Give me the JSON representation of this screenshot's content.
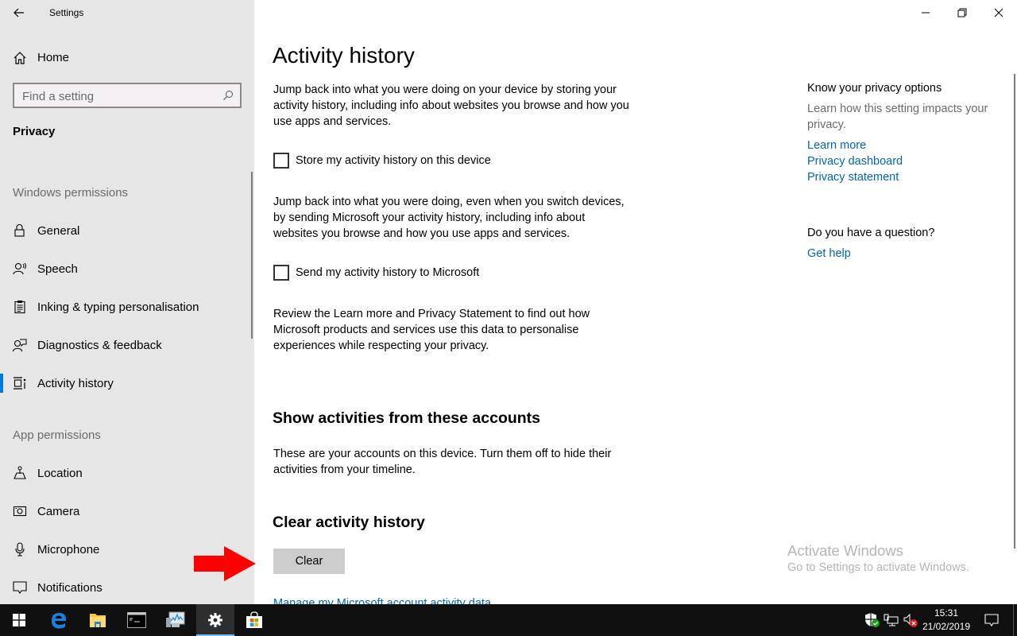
{
  "window": {
    "app_title": "Settings",
    "controls": {
      "minimize": "minimize-icon",
      "restore": "restore-icon",
      "close": "close-icon"
    }
  },
  "sidebar": {
    "home_label": "Home",
    "search_placeholder": "Find a setting",
    "category_title": "Privacy",
    "groups": [
      {
        "title": "Windows permissions",
        "items": [
          {
            "label": "General",
            "icon": "lock-icon"
          },
          {
            "label": "Speech",
            "icon": "speech-icon"
          },
          {
            "label": "Inking & typing personalisation",
            "icon": "clipboard-icon"
          },
          {
            "label": "Diagnostics & feedback",
            "icon": "feedback-icon"
          },
          {
            "label": "Activity history",
            "icon": "timeline-icon",
            "active": true
          }
        ]
      },
      {
        "title": "App permissions",
        "items": [
          {
            "label": "Location",
            "icon": "location-icon"
          },
          {
            "label": "Camera",
            "icon": "camera-icon"
          },
          {
            "label": "Microphone",
            "icon": "microphone-icon"
          },
          {
            "label": "Notifications",
            "icon": "notifications-icon"
          }
        ]
      }
    ]
  },
  "main": {
    "title": "Activity history",
    "intro": "Jump back into what you were doing on your device by storing your activity history, including info about websites you browse and how you use apps and services.",
    "store_checkbox": {
      "label": "Store my activity history on this device",
      "checked": false
    },
    "send_desc": "Jump back into what you were doing, even when you switch devices, by sending Microsoft your activity history, including info about websites you browse and how you use apps and services.",
    "send_checkbox": {
      "label": "Send my activity history to Microsoft",
      "checked": false
    },
    "review_text": "Review the Learn more and Privacy Statement to find out how Microsoft products and services use this data to personalise experiences while respecting your privacy.",
    "accounts_title": "Show activities from these accounts",
    "accounts_desc": "These are your accounts on this device. Turn them off to hide their activities from your timeline.",
    "clear_title": "Clear activity history",
    "clear_button": "Clear",
    "manage_link": "Manage my Microsoft account activity data"
  },
  "right_panel": {
    "privacy_title": "Know your privacy options",
    "privacy_desc": "Learn how this setting impacts your privacy.",
    "links": [
      "Learn more",
      "Privacy dashboard",
      "Privacy statement"
    ],
    "question_title": "Do you have a question?",
    "help_link": "Get help"
  },
  "watermark": {
    "line1": "Activate Windows",
    "line2": "Go to Settings to activate Windows."
  },
  "taskbar": {
    "apps": [
      "start-icon",
      "edge-icon",
      "file-explorer-icon",
      "command-prompt-icon",
      "performance-monitor-icon",
      "settings-icon",
      "store-icon"
    ],
    "active_app": "settings-icon",
    "time": "15:31",
    "date": "21/02/2019"
  },
  "colors": {
    "accent": "#0078d7",
    "link": "#0067b8",
    "sidebar_bg": "#e6e6e6",
    "annotation_arrow": "#ff0000"
  }
}
